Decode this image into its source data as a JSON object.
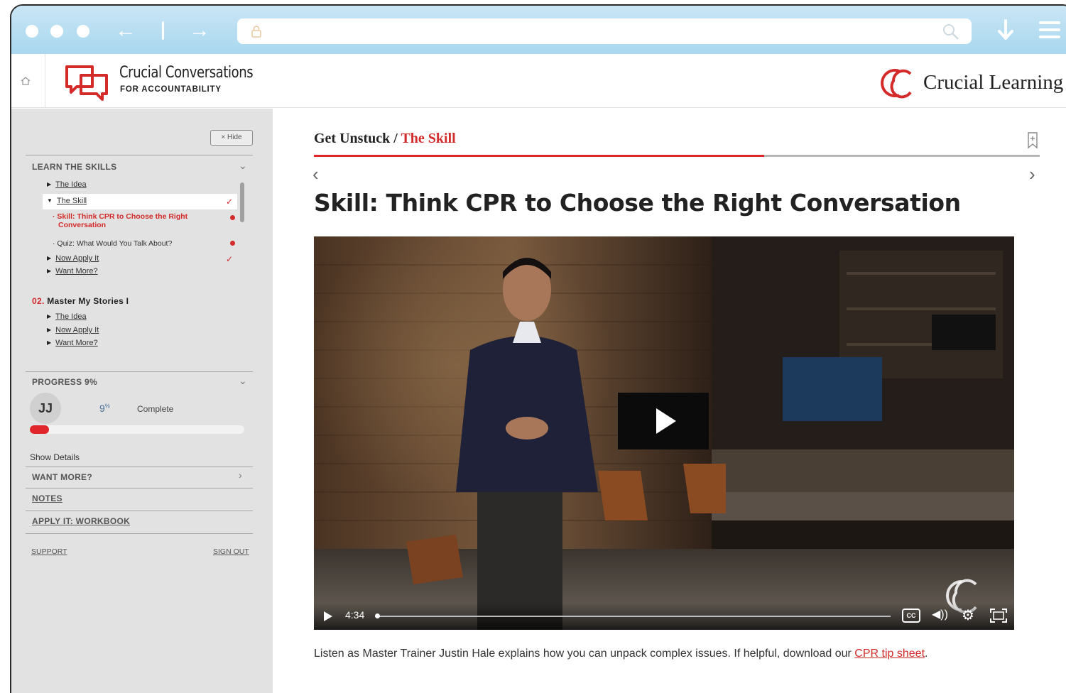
{
  "header": {
    "product_title": "Crucial Conversations",
    "product_subtitle": "FOR ACCOUNTABILITY",
    "brand_name": "Crucial Learning"
  },
  "sidebar": {
    "hide_label": "× Hide",
    "learn_section": "LEARN THE SKILLS",
    "module1_items": [
      {
        "label": "The Idea"
      },
      {
        "label": "The Skill"
      },
      {
        "label": "Skill: Think CPR to Choose the Right",
        "label2": "Conversation"
      },
      {
        "label": "Quiz: What Would You Talk About?"
      },
      {
        "label": "Now Apply It"
      },
      {
        "label": "Want More?"
      }
    ],
    "module2_number": "02.",
    "module2_title": "Master My Stories I",
    "module2_items": [
      {
        "label": "The Idea"
      },
      {
        "label": "Now Apply It"
      },
      {
        "label": "Want More?"
      }
    ],
    "progress_heading": "PROGRESS 9%",
    "avatar_initials": "JJ",
    "progress_value": "9",
    "progress_unit": "%",
    "progress_label": "Complete",
    "progress_fraction": 0.09,
    "show_details": "Show Details",
    "want_more": "WANT MORE?",
    "notes": "NOTES",
    "workbook": "APPLY IT: WORKBOOK",
    "support": "SUPPORT",
    "sign_out": "SIGN OUT"
  },
  "main": {
    "breadcrumb_parent": "Get Unstuck",
    "breadcrumb_sep": " / ",
    "breadcrumb_current": "The Skill",
    "lesson_progress_fraction": 0.62,
    "title": "Skill: Think CPR to Choose the Right Conversation",
    "video": {
      "time": "4:34",
      "cc_label": "CC"
    },
    "caption_text": "Listen as Master Trainer Justin Hale explains how you can unpack complex issues. If helpful, download our ",
    "caption_link": "CPR tip sheet",
    "caption_end": "."
  },
  "colors": {
    "accent": "#d32a2a",
    "chrome": "#b3dcf1",
    "sidebar": "#e2e2e2"
  }
}
